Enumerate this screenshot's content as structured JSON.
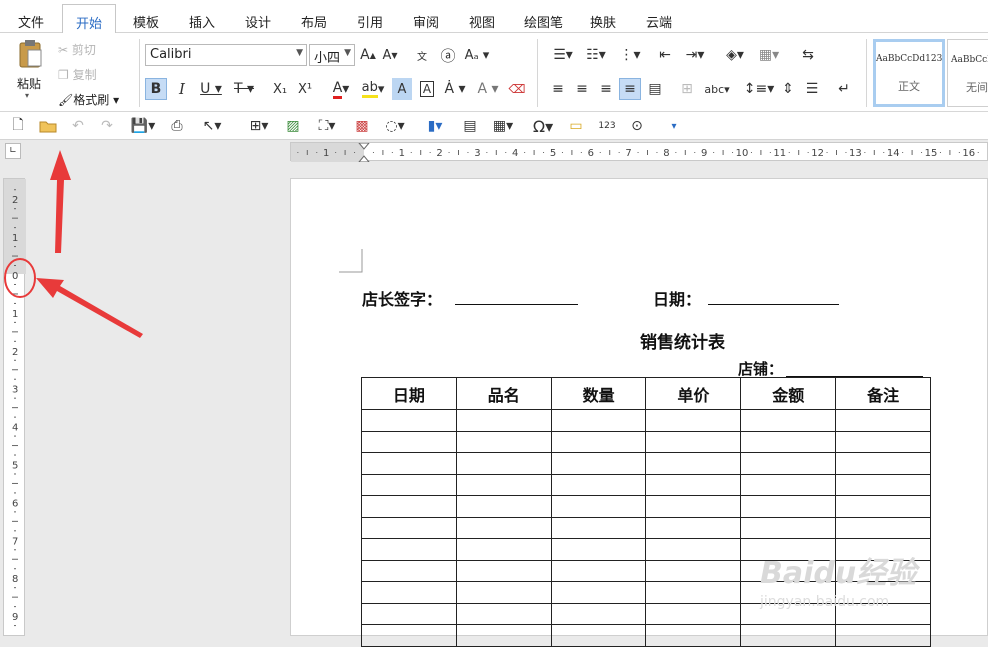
{
  "menu": [
    "文件",
    "开始",
    "模板",
    "插入",
    "设计",
    "布局",
    "引用",
    "审阅",
    "视图",
    "绘图笔",
    "换肤",
    "云端"
  ],
  "clipboard": {
    "paste": "粘贴",
    "cut": "剪切",
    "copy": "复制",
    "format_painter": "格式刷"
  },
  "font": {
    "family": "Calibri",
    "size": "小四"
  },
  "styles": {
    "sample": "AaBbCcDd123",
    "sample2": "AaBbCcDd",
    "normal": "正文",
    "no_spacing": "无间"
  },
  "ruler_h": [
    "1",
    "1",
    "2",
    "3",
    "4",
    "5",
    "6",
    "7",
    "8",
    "9",
    "10",
    "11",
    "12",
    "13",
    "14",
    "15",
    "16"
  ],
  "ruler_v": [
    "2",
    "1",
    "0",
    "1",
    "2",
    "3",
    "4",
    "5",
    "6",
    "7",
    "8",
    "9"
  ],
  "doc": {
    "manager_sign": "店长签字：",
    "date_label": "日期：",
    "title": "销售统计表",
    "store_label": "店铺：",
    "headers": [
      "日期",
      "品名",
      "数量",
      "单价",
      "金额",
      "备注"
    ]
  },
  "watermark": {
    "logo": "Baidu经验",
    "url": "jingyan.baidu.com"
  },
  "colors": {
    "accent": "#2b6cc4",
    "annotation": "#e83a3a",
    "selected_style": "#a9cdf0"
  }
}
